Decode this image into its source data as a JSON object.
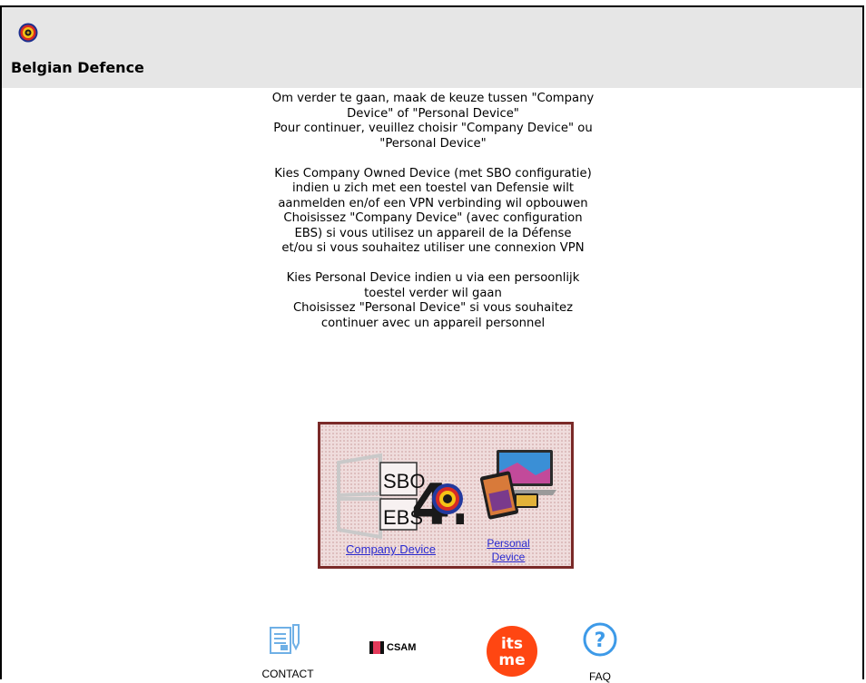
{
  "header": {
    "title": "Belgian Defence"
  },
  "intro": {
    "nl_choice": [
      "Om verder te gaan, maak de keuze tussen \"Company",
      "Device\" of \"Personal Device\""
    ],
    "fr_choice": [
      "Pour continuer, veuillez choisir \"Company Device\" ou",
      "\"Personal Device\""
    ],
    "nl_company": [
      "Kies Company Owned Device (met SBO configuratie)",
      "indien u zich met een toestel van Defensie wilt",
      "aanmelden en/of een VPN verbinding wil opbouwen"
    ],
    "fr_company": [
      "Choisissez \"Company Device\" (avec configuration",
      "EBS) si vous utilisez un appareil de la Défense",
      "et/ou si vous souhaitez utiliser une connexion VPN"
    ],
    "nl_personal": [
      "Kies Personal Device indien u via een persoonlijk",
      "toestel verder wil gaan"
    ],
    "fr_personal": [
      "Choisissez \"Personal Device\" si vous souhaitez",
      "continuer avec un appareil personnel"
    ]
  },
  "choices": {
    "company_label": "Company Device",
    "personal_label_line1": "Personal",
    "personal_label_line2": "Device",
    "logo_text": {
      "sbo": "SBO",
      "ebs": "EBS",
      "version": "4.0"
    }
  },
  "footer": {
    "contact_label": "CONTACT",
    "csam_label": "CSAM",
    "itsme_text_top": "its",
    "itsme_text_bottom": "me",
    "faq_label": "FAQ"
  },
  "colors": {
    "header_bg": "#e6e6e6",
    "link": "#2a2ad0",
    "box_border": "#7a2a28",
    "itsme": "#ff4612",
    "faq_icon": "#3d9ae8"
  },
  "icons": {
    "logo": "belgian-defence-roundel-icon",
    "contact": "contact-form-icon",
    "csam": "csam-logo-icon",
    "itsme": "itsme-logo-icon",
    "faq": "question-circle-icon"
  }
}
